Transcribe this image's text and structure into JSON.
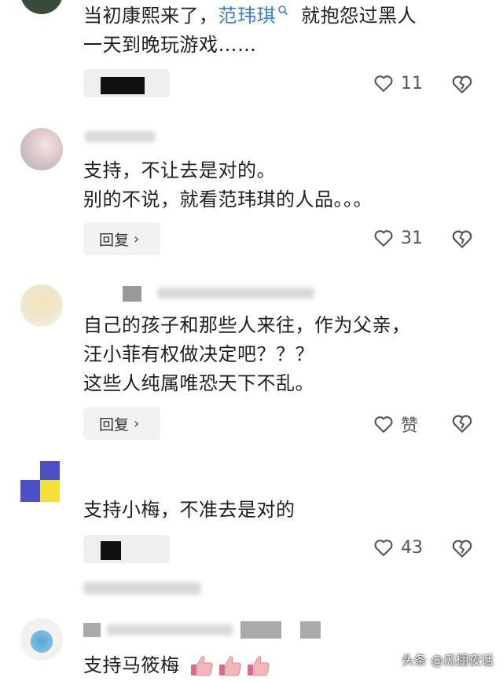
{
  "comments": [
    {
      "text_line1_a": "当初康熙来了，",
      "text_line1_mention": "范玮琪",
      "text_line1_b": "就抱怨过黑人",
      "text_line2": "一天到晚玩游戏……",
      "likes": "11"
    },
    {
      "text_line1": "支持，不让去是对的。",
      "text_line2": "别的不说，就看范玮琪的人品。。。",
      "reply_label": "回复",
      "likes": "31"
    },
    {
      "text_line1": "自己的孩子和那些人来往，作为父亲，",
      "text_line2": "汪小菲有权做决定吧？？？",
      "text_line3": "这些人纯属唯恐天下不乱。",
      "reply_label": "回复",
      "likes": "赞"
    },
    {
      "text_line1": "支持小梅，不准去是对的",
      "likes": "43"
    },
    {
      "text_line1": "支持马筱梅"
    }
  ],
  "icons": {
    "like": "heart-icon",
    "dislike": "broken-heart-icon",
    "emoji": "thumbs-up-emoji"
  },
  "colors": {
    "mention": "#3b7fc4",
    "reply_bg": "#f2f2f2"
  },
  "watermark": "头条 @瓜棚夜话"
}
